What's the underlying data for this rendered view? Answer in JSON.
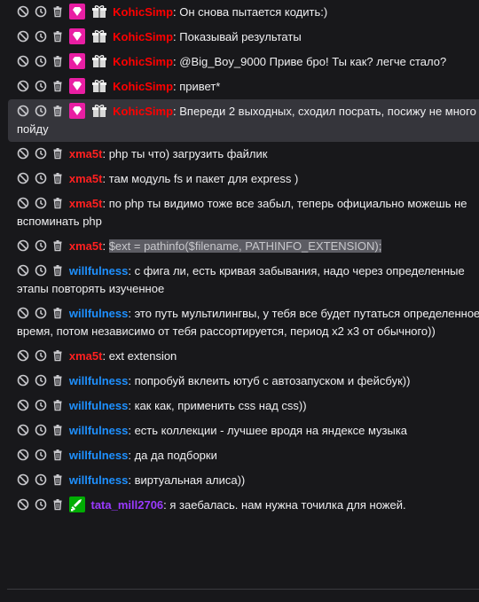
{
  "colors": {
    "background": "#18181b",
    "highlight_row": "#35353b",
    "kohic_simp": "#ff0000",
    "xma5t": "#ff2020",
    "willfulness": "#1e90ff",
    "tata_mill": "#9a3aff",
    "subscriber_badge": "#e91ea3",
    "moderator_badge": "#00ad03"
  },
  "icons": {
    "ban": "ban-icon",
    "timeout": "clock-icon",
    "delete": "trash-icon",
    "subscriber": "diamond-badge-icon",
    "gift": "gift-badge-icon",
    "moderator": "sword-badge-icon"
  },
  "messages": [
    {
      "user": "KohicSimp",
      "text": "Он снова пытается кодить:)"
    },
    {
      "user": "KohicSimp",
      "text": "Показывай результаты"
    },
    {
      "user": "KohicSimp",
      "text": "@Big_Boy_9000  Приве бро! Ты как? легче стало?"
    },
    {
      "user": "KohicSimp",
      "text": "привет*"
    },
    {
      "user": "KohicSimp",
      "text": "Впереди 2 выходных, сходил посрать, посижу не много и пойду"
    },
    {
      "user": "xma5t",
      "text": "php ты что) загрузить файлик"
    },
    {
      "user": "xma5t",
      "text": "там модуль fs и пакет для express )"
    },
    {
      "user": "xma5t",
      "text": "по php ты видимо тоже все забыл, теперь официально можешь не вспоминать php"
    },
    {
      "user": "xma5t",
      "text": "$ext = pathinfo($filename, PATHINFO_EXTENSION);"
    },
    {
      "user": "willfulness",
      "text": "с фига ли, есть кривая забывания, надо через определенные этапы повторять изученное"
    },
    {
      "user": "willfulness",
      "text": "это путь мультилингвы, у тебя все будет путаться определенное время, потом независимо от тебя рассортируется, период x2 x3 от обычного))"
    },
    {
      "user": "xma5t",
      "text": "ext extension"
    },
    {
      "user": "willfulness",
      "text": "попробуй вклеить ютуб с автозапуском и фейсбук))"
    },
    {
      "user": "willfulness",
      "text": "как как, применить css над css))"
    },
    {
      "user": "willfulness",
      "text": "есть коллекции - лучшее вродя на яндексе музыка"
    },
    {
      "user": "willfulness",
      "text": "да да подборки"
    },
    {
      "user": "willfulness",
      "text": "виртуальная алиса))"
    },
    {
      "user": "tata_mill2706",
      "text": "я заебалась. нам нужна точилка для ножей."
    }
  ]
}
